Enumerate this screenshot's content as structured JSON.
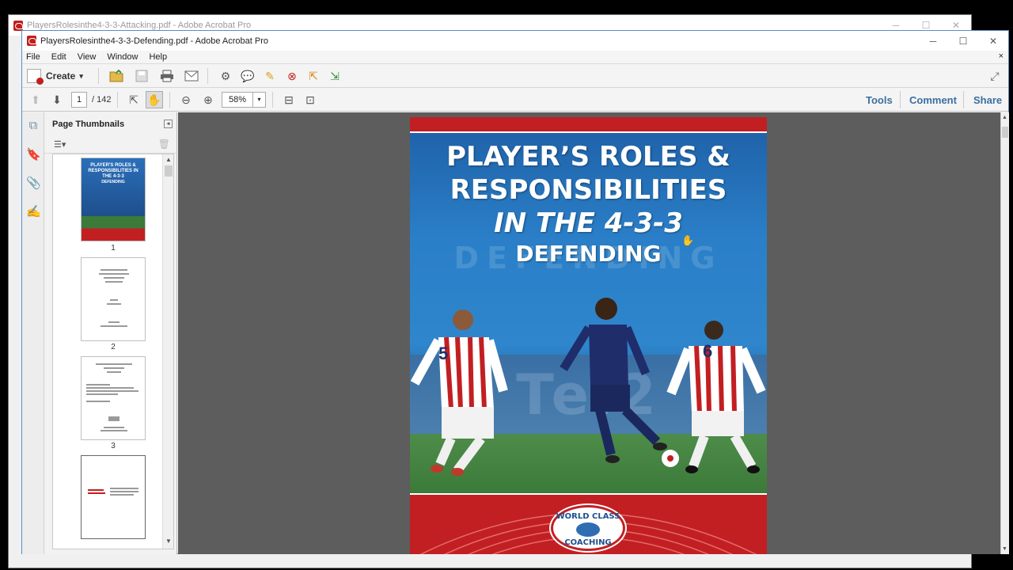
{
  "background_window": {
    "title": "PlayersRolesinthe4-3-3-Attacking.pdf - Adobe Acrobat Pro"
  },
  "window": {
    "title": "PlayersRolesinthe4-3-3-Defending.pdf - Adobe Acrobat Pro",
    "minimize": "─",
    "maximize": "☐",
    "close": "✕"
  },
  "menu": [
    "File",
    "Edit",
    "View",
    "Window",
    "Help"
  ],
  "menu_close": "×",
  "toolbar": {
    "create_label": "Create",
    "create_arrow": "▾"
  },
  "nav": {
    "page_value": "1",
    "page_total": "/ 142",
    "zoom": "58%",
    "zoom_arrow": "▾"
  },
  "right_links": {
    "tools": "Tools",
    "comment": "Comment",
    "share": "Share"
  },
  "thumbnails": {
    "header": "Page Thumbnails",
    "pages": [
      "1",
      "2",
      "3"
    ],
    "t1_title": "PLAYER'S ROLES & RESPONSIBILITIES IN THE 4-3-3",
    "t1_sub": "DEFENDING"
  },
  "cover": {
    "line1": "PLAYER’S ROLES &",
    "line2": "RESPONSIBILITIES",
    "line3": "IN THE 4-3-3",
    "line4": "DEFENDING",
    "ghost": "DEFENDING",
    "logo_top": "WORLD CLASS",
    "logo_bottom": "COACHING",
    "player_left_number": "5",
    "player_right_number": "6"
  },
  "colors": {
    "accent_red": "#c21f23",
    "cover_blue": "#2a7fc8",
    "link_blue": "#3a6fa0"
  }
}
